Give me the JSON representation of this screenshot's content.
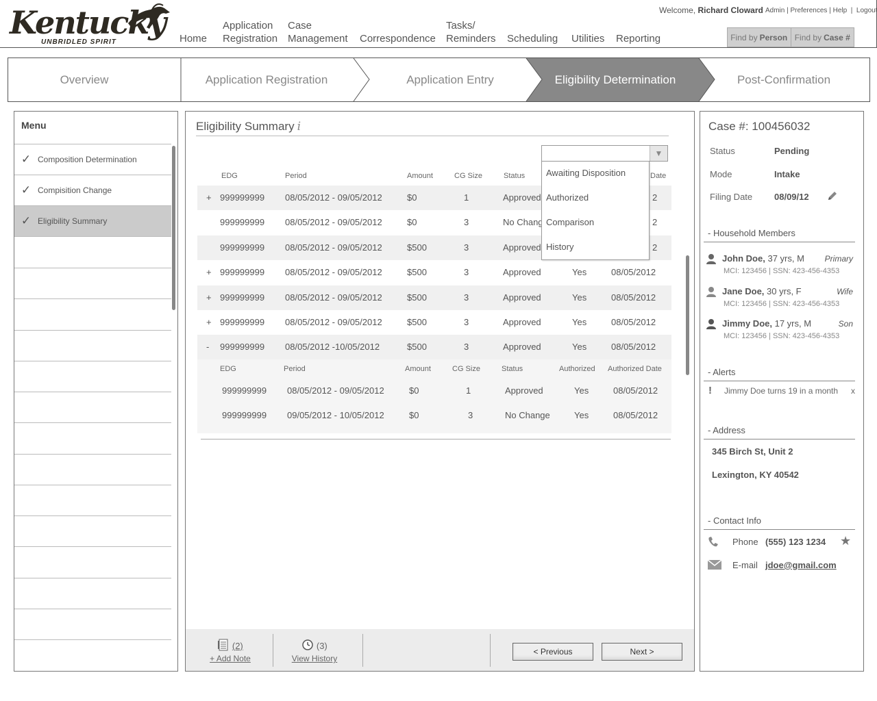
{
  "header": {
    "logo_word": "Kentucky",
    "logo_tag": "UNBRIDLED SPIRIT",
    "welcome_prefix": "Welcome,",
    "welcome_user": "Richard Cloward",
    "links": [
      "Admin",
      "Preferences",
      "Help",
      "Logout"
    ],
    "nav": [
      {
        "l1": "",
        "l2": "Home"
      },
      {
        "l1": "Application",
        "l2": "Registration"
      },
      {
        "l1": "Case",
        "l2": "Management"
      },
      {
        "l1": "",
        "l2": "Correspondence"
      },
      {
        "l1": "Tasks/",
        "l2": "Reminders"
      },
      {
        "l1": "",
        "l2": "Scheduling"
      },
      {
        "l1": "",
        "l2": "Utilities"
      },
      {
        "l1": "",
        "l2": "Reporting"
      }
    ],
    "find_person_label": "Find by",
    "find_person_key": "Person",
    "find_case_label": "Find by",
    "find_case_key": "Case #"
  },
  "steps": [
    "Overview",
    "Application Registration",
    "Application Entry",
    "Eligibility Determination",
    "Post-Confirmation"
  ],
  "menu": {
    "title": "Menu",
    "items": [
      {
        "label": "Composition Determination",
        "checked": true
      },
      {
        "label": "Compisition Change",
        "checked": true
      },
      {
        "label": "Eligibility Summary",
        "checked": true
      }
    ]
  },
  "main": {
    "title": "Eligibility Summary",
    "info_glyph": "i",
    "columns": [
      "EDG",
      "Period",
      "Amount",
      "CG Size",
      "Status",
      "Authorized",
      "Authorized Date"
    ],
    "visible_date_header": "Date",
    "rows": [
      {
        "toggle": "+",
        "edg": "999999999",
        "period": "08/05/2012 - 09/05/2012",
        "amount": "$0",
        "cg": "1",
        "status": "Approved",
        "auth": "",
        "date": "2"
      },
      {
        "toggle": "",
        "edg": "999999999",
        "period": "08/05/2012 - 09/05/2012",
        "amount": "$0",
        "cg": "3",
        "status": "No Chang",
        "auth": "",
        "date": "2"
      },
      {
        "toggle": "",
        "edg": "999999999",
        "period": "08/05/2012 - 09/05/2012",
        "amount": "$500",
        "cg": "3",
        "status": "Approved",
        "auth": "",
        "date": "2"
      },
      {
        "toggle": "+",
        "edg": "999999999",
        "period": "08/05/2012 - 09/05/2012",
        "amount": "$500",
        "cg": "3",
        "status": "Approved",
        "auth": "Yes",
        "date": "08/05/2012"
      },
      {
        "toggle": "+",
        "edg": "999999999",
        "period": "08/05/2012 - 09/05/2012",
        "amount": "$500",
        "cg": "3",
        "status": "Approved",
        "auth": "Yes",
        "date": "08/05/2012"
      },
      {
        "toggle": "+",
        "edg": "999999999",
        "period": "08/05/2012 - 09/05/2012",
        "amount": "$500",
        "cg": "3",
        "status": "Approved",
        "auth": "Yes",
        "date": "08/05/2012"
      },
      {
        "toggle": "-",
        "edg": "999999999",
        "period": "08/05/2012 -10/05/2012",
        "amount": "$500",
        "cg": "3",
        "status": "Approved",
        "auth": "Yes",
        "date": "08/05/2012"
      }
    ],
    "sub_rows": [
      {
        "edg": "999999999",
        "period": "08/05/2012 - 09/05/2012",
        "amount": "$0",
        "cg": "1",
        "status": "Approved",
        "auth": "Yes",
        "date": "08/05/2012"
      },
      {
        "edg": "999999999",
        "period": "09/05/2012 - 10/05/2012",
        "amount": "$0",
        "cg": "3",
        "status": "No Change",
        "auth": "Yes",
        "date": "08/05/2012"
      }
    ],
    "dropdown": {
      "value": "",
      "options": [
        "Awaiting Disposition",
        "Authorized",
        "Comparison",
        "History"
      ]
    },
    "footer": {
      "notes_count": "(2)",
      "add_note": "+ Add Note",
      "history_count": "(3)",
      "view_history": "View History",
      "previous": "< Previous",
      "next": "Next >"
    }
  },
  "case": {
    "title": "Case #: 100456032",
    "fields": [
      {
        "k": "Status",
        "v": "Pending"
      },
      {
        "k": "Mode",
        "v": "Intake"
      },
      {
        "k": "Filing Date",
        "v": "08/09/12"
      }
    ],
    "household_title": "- Household Members",
    "members": [
      {
        "name": "John Doe,",
        "info": "37 yrs,   M",
        "rel": "Primary",
        "mci": "MCI: 123456 | SSN: 423-456-4353"
      },
      {
        "name": "Jane Doe,",
        "info": "30 yrs,   F",
        "rel": "Wife",
        "mci": "MCI: 123456 | SSN: 423-456-4353"
      },
      {
        "name": "Jimmy Doe,",
        "info": "17 yrs,  M",
        "rel": "Son",
        "mci": "MCI: 123456 | SSN: 423-456-4353"
      }
    ],
    "alerts_title": "- Alerts",
    "alert_text": "Jimmy Doe turns 19 in a month",
    "alert_close": "x",
    "address_title": "- Address",
    "address1": "345 Birch St, Unit 2",
    "address2": "Lexington, KY 40542",
    "contact_title": "- Contact Info",
    "phone_label": "Phone",
    "phone": "(555) 123 1234",
    "email_label": "E-mail",
    "email": "jdoe@gmail.com"
  }
}
